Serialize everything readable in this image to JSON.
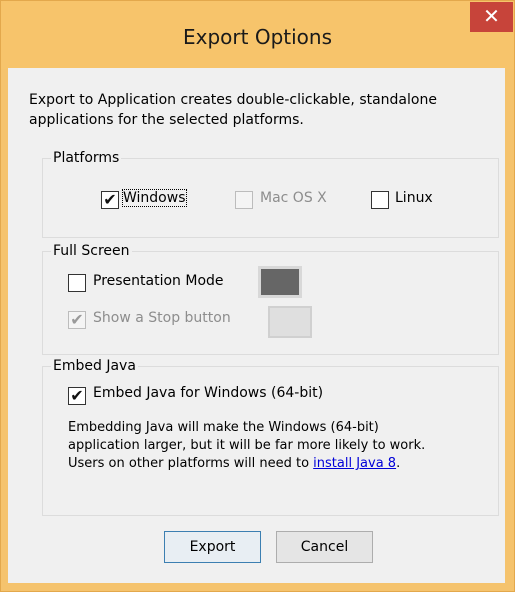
{
  "window": {
    "title": "Export Options",
    "close_glyph": "✕"
  },
  "intro_text": "Export to Application creates double-clickable, standalone applications for the selected platforms.",
  "platforms": {
    "label": "Platforms",
    "windows": {
      "label": "Windows",
      "checked": true
    },
    "mac": {
      "label": "Mac OS X",
      "checked": false,
      "enabled": false
    },
    "linux": {
      "label": "Linux",
      "checked": false
    }
  },
  "full_screen": {
    "label": "Full Screen",
    "presentation_mode": {
      "label": "Presentation Mode",
      "checked": false,
      "color": "#666666"
    },
    "stop_button": {
      "label": "Show a Stop button",
      "checked": true,
      "enabled": false,
      "color": "#dfdfdf"
    }
  },
  "embed_java": {
    "label": "Embed Java",
    "checkbox": {
      "label": "Embed Java for Windows (64-bit)",
      "checked": true
    },
    "desc_before": "Embedding Java will make the Windows (64-bit) application larger, but it will be far more likely to work. Users on other platforms will need to ",
    "link": "install Java 8",
    "desc_after": "."
  },
  "buttons": {
    "export": "Export",
    "cancel": "Cancel"
  },
  "check_glyph": "✔"
}
